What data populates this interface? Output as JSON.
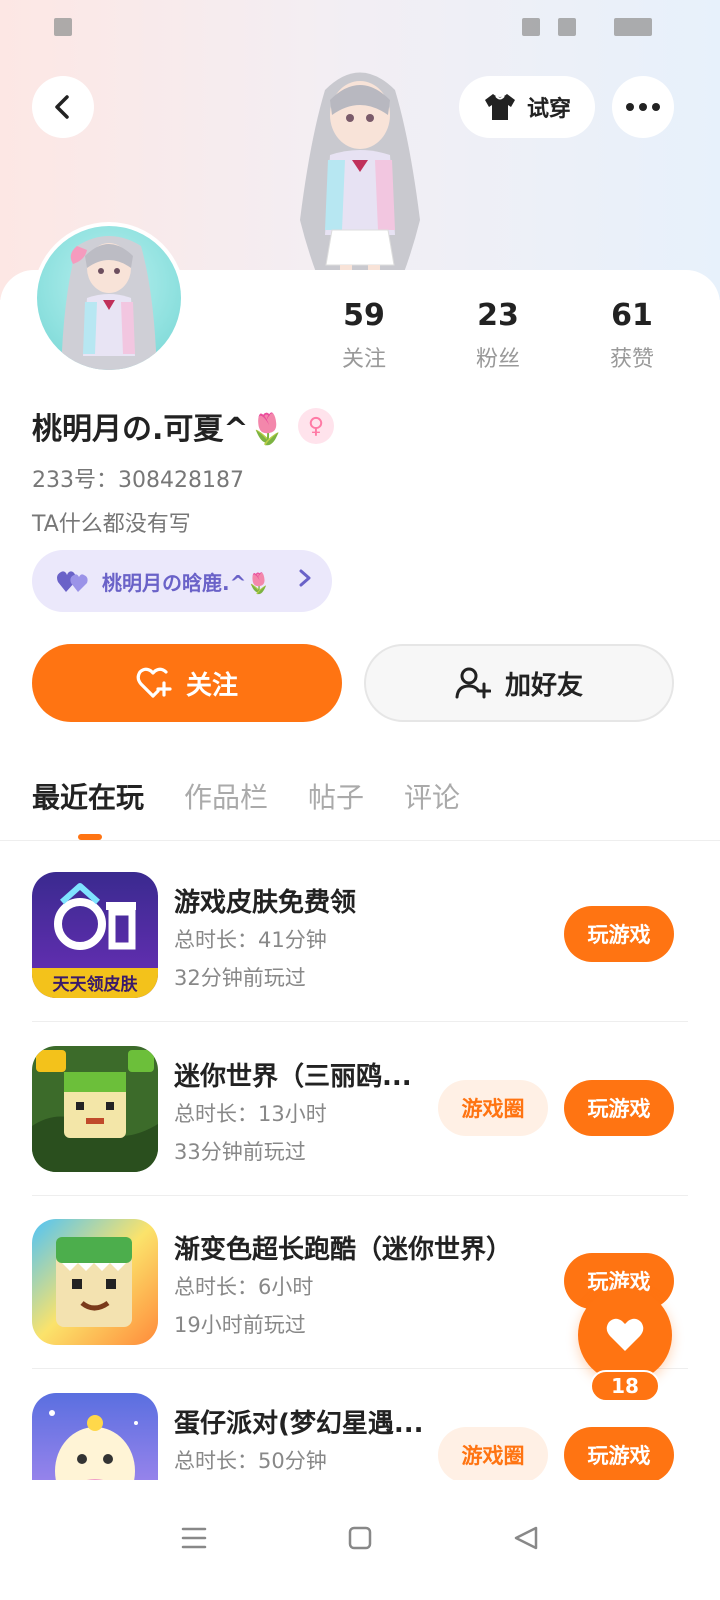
{
  "header": {
    "try_on_label": "试穿"
  },
  "profile": {
    "name": "桃明月の.可夏^🌷",
    "gender_symbol": "♀",
    "uid": "233号：308428187",
    "bio": "TA什么都没有写",
    "cp_label": "桃明月の晗鹿.^🌷",
    "stats": [
      {
        "num": "59",
        "label": "关注"
      },
      {
        "num": "23",
        "label": "粉丝"
      },
      {
        "num": "61",
        "label": "获赞"
      }
    ]
  },
  "actions": {
    "follow_label": "关注",
    "add_friend_label": "加好友"
  },
  "tabs": [
    {
      "label": "最近在玩"
    },
    {
      "label": "作品栏"
    },
    {
      "label": "帖子"
    },
    {
      "label": "评论"
    }
  ],
  "games": [
    {
      "title": "游戏皮肤免费领",
      "duration": "总时长：41分钟",
      "last_played": "32分钟前玩过",
      "play_label": "玩游戏",
      "icon_text": "天天领皮肤"
    },
    {
      "title": "迷你世界（三丽鸥...",
      "duration": "总时长：13小时",
      "last_played": "33分钟前玩过",
      "play_label": "玩游戏",
      "circle_label": "游戏圈"
    },
    {
      "title": "渐变色超长跑酷（迷你世界）",
      "duration": "总时长：6小时",
      "last_played": "19小时前玩过",
      "play_label": "玩游戏"
    },
    {
      "title": "蛋仔派对(梦幻星遇...",
      "duration": "总时长：50分钟",
      "last_played": "",
      "play_label": "玩游戏",
      "circle_label": "游戏圈"
    }
  ],
  "floating": {
    "like_count": "18"
  },
  "colors": {
    "accent": "#ff7412",
    "cp_purple": "#6a62c8"
  }
}
